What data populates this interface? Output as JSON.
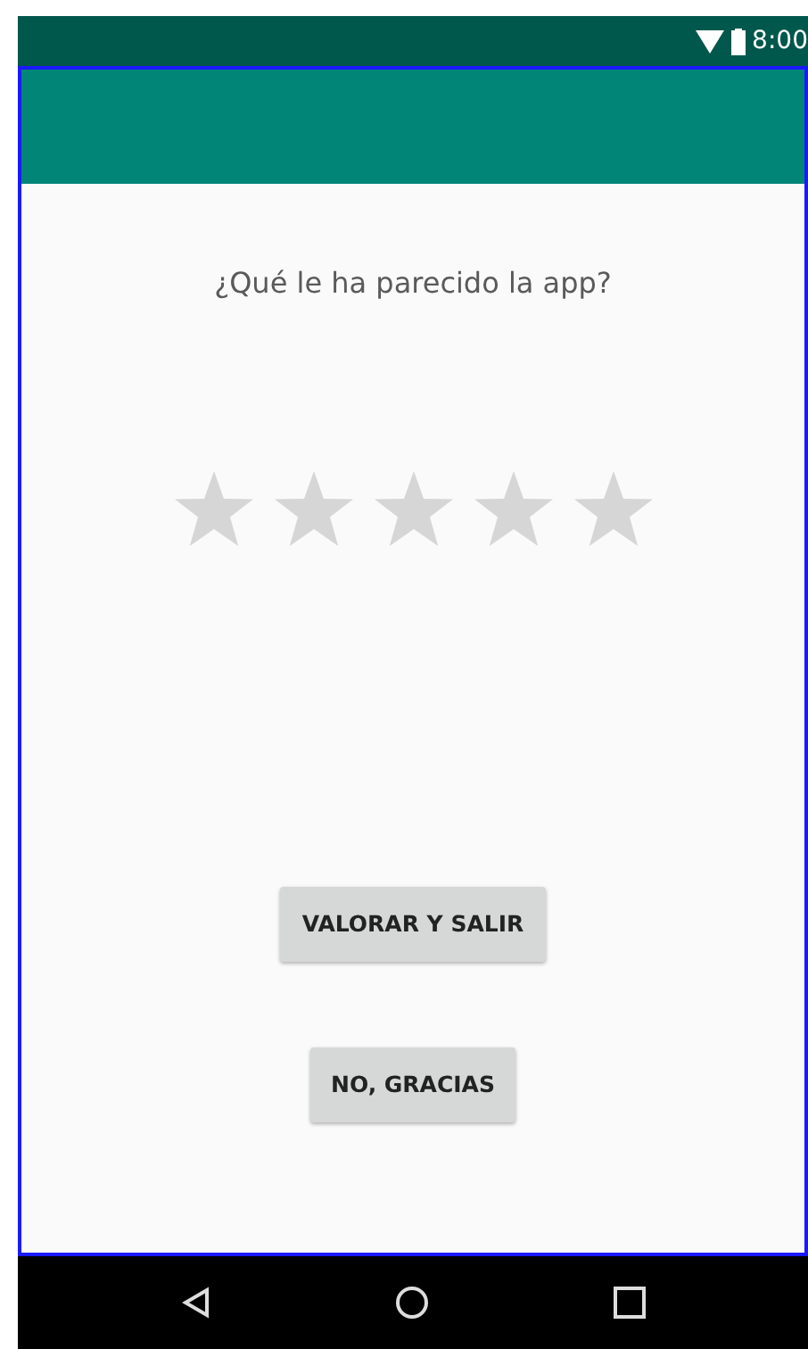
{
  "status_bar": {
    "time": "8:00"
  },
  "rating_prompt": {
    "question": "¿Qué le ha parecido la app?",
    "stars": 0
  },
  "buttons": [
    {
      "label": "VALORAR Y SALIR"
    },
    {
      "label": "NO, GRACIAS"
    }
  ]
}
